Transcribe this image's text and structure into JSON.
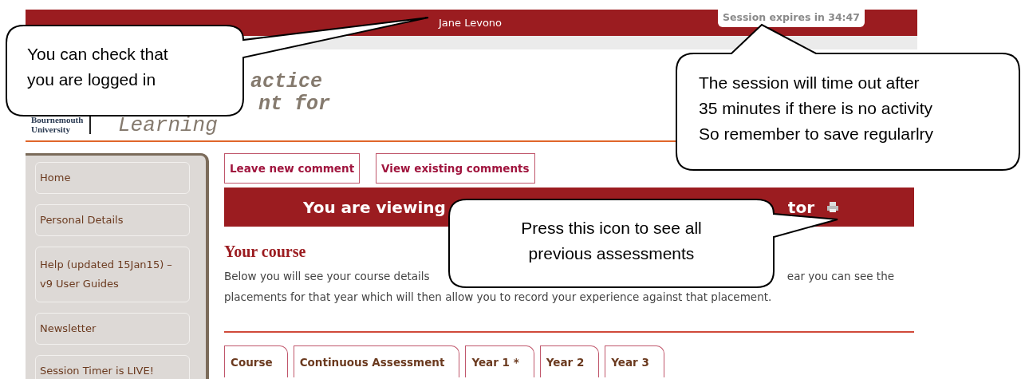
{
  "top_bar": {
    "user_name": "Jane Levono",
    "session_timer": "Session expires in 34:47"
  },
  "header": {
    "logo_lines": [
      "Bournemouth",
      "University"
    ],
    "title_fragments": [
      "actice",
      "nt for"
    ],
    "title_last": "Learning"
  },
  "sidebar": {
    "items": [
      "Home",
      "Personal Details",
      "Help (updated 15Jan15) – v9 User Guides",
      "Newsletter",
      "Session Timer is LIVE!"
    ]
  },
  "actions": [
    "Leave new comment",
    "View existing comments"
  ],
  "banner": {
    "text_left": "You are viewing",
    "text_right": "tor"
  },
  "section": {
    "heading": "Your course",
    "line_1_start": "Below you will see your course details",
    "line_1_end": "ear you can see the",
    "line_2": "placements for that year which will then allow you to record your experience against that placement."
  },
  "tabs": [
    "Course",
    "Continuous Assessment",
    "Year 1 *",
    "Year 2",
    "Year 3"
  ],
  "callouts": [
    {
      "kind": "left",
      "lines": [
        "You can check that",
        "you are logged in"
      ]
    },
    {
      "kind": "right",
      "lines": [
        "The session will time out after",
        "35 minutes if there is no activity",
        "So remember to save regularlry"
      ]
    },
    {
      "kind": "center",
      "lines": [
        "Press this icon to see all",
        "previous assessments"
      ]
    }
  ]
}
